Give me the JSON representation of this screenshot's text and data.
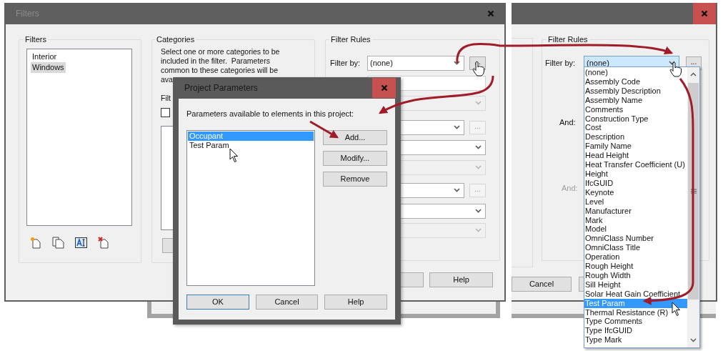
{
  "filters_window": {
    "title": "Filters",
    "filters_group": {
      "label": "Filters",
      "items": [
        {
          "label": "Interior",
          "selected": false
        },
        {
          "label": "Windows",
          "selected": true
        }
      ]
    },
    "categories_group": {
      "label": "Categories",
      "description_lines": [
        "Select one or more categories to be",
        "included in the filter.  Parameters",
        "common to these categories will be",
        "ava"
      ],
      "filter_label": "Filt",
      "checkbox_checked": false
    },
    "filter_rules": {
      "label": "Filter Rules",
      "filter_by_label": "Filter by:",
      "filter_by_value": "(none)",
      "more_button": "...",
      "rows": [
        {
          "kind": "field",
          "disabled": false
        },
        {
          "kind": "combo",
          "disabled": true
        },
        {
          "kind": "combo",
          "disabled": false,
          "more_button": "..."
        },
        {
          "kind": "combo",
          "disabled": false
        },
        {
          "kind": "combo",
          "disabled": true
        },
        {
          "kind": "combo",
          "disabled": false,
          "more_button": "..."
        },
        {
          "kind": "combo",
          "disabled": false
        },
        {
          "kind": "combo",
          "disabled": true
        }
      ]
    },
    "buttons": [
      {
        "label": "Help"
      }
    ]
  },
  "project_parameters": {
    "title": "Project Parameters",
    "prompt": "Parameters available to elements in this project:",
    "parameters": [
      {
        "label": "Occupant",
        "selected": true
      },
      {
        "label": "Test Param",
        "selected": false
      }
    ],
    "side_buttons": [
      "Add...",
      "Modify...",
      "Remove"
    ],
    "bottom_buttons": [
      {
        "label": "OK",
        "default": true
      },
      {
        "label": "Cancel",
        "default": false
      },
      {
        "label": "Help",
        "default": false
      }
    ]
  },
  "filters_window_2": {
    "filter_rules": {
      "label": "Filter Rules",
      "filter_by_label": "Filter by:",
      "filter_by_value": "(none)",
      "more_button": "...",
      "and_labels": [
        {
          "label": "And:",
          "disabled": false
        },
        {
          "label": "And:",
          "disabled": true
        }
      ],
      "dropdown": [
        {
          "label": "(none)",
          "selected": false
        },
        {
          "label": "Assembly Code",
          "selected": false
        },
        {
          "label": "Assembly Description",
          "selected": false
        },
        {
          "label": "Assembly Name",
          "selected": false
        },
        {
          "label": "Comments",
          "selected": false
        },
        {
          "label": "Construction Type",
          "selected": false
        },
        {
          "label": "Cost",
          "selected": false
        },
        {
          "label": "Description",
          "selected": false
        },
        {
          "label": "Family Name",
          "selected": false
        },
        {
          "label": "Head Height",
          "selected": false
        },
        {
          "label": "Heat Transfer Coefficient (U)",
          "selected": false
        },
        {
          "label": "Height",
          "selected": false
        },
        {
          "label": "IfcGUID",
          "selected": false
        },
        {
          "label": "Keynote",
          "selected": false
        },
        {
          "label": "Level",
          "selected": false
        },
        {
          "label": "Manufacturer",
          "selected": false
        },
        {
          "label": "Mark",
          "selected": false
        },
        {
          "label": "Model",
          "selected": false
        },
        {
          "label": "OmniClass Number",
          "selected": false
        },
        {
          "label": "OmniClass Title",
          "selected": false
        },
        {
          "label": "Operation",
          "selected": false
        },
        {
          "label": "Rough Height",
          "selected": false
        },
        {
          "label": "Rough Width",
          "selected": false
        },
        {
          "label": "Sill Height",
          "selected": false
        },
        {
          "label": "Solar Heat Gain Coefficient",
          "selected": false
        },
        {
          "label": "Test Param",
          "selected": true
        },
        {
          "label": "Thermal Resistance (R)",
          "selected": false
        },
        {
          "label": "Type Comments",
          "selected": false
        },
        {
          "label": "Type IfcGUID",
          "selected": false
        },
        {
          "label": "Type Mark",
          "selected": false
        }
      ]
    },
    "buttons": [
      {
        "label": "Cancel"
      }
    ]
  }
}
